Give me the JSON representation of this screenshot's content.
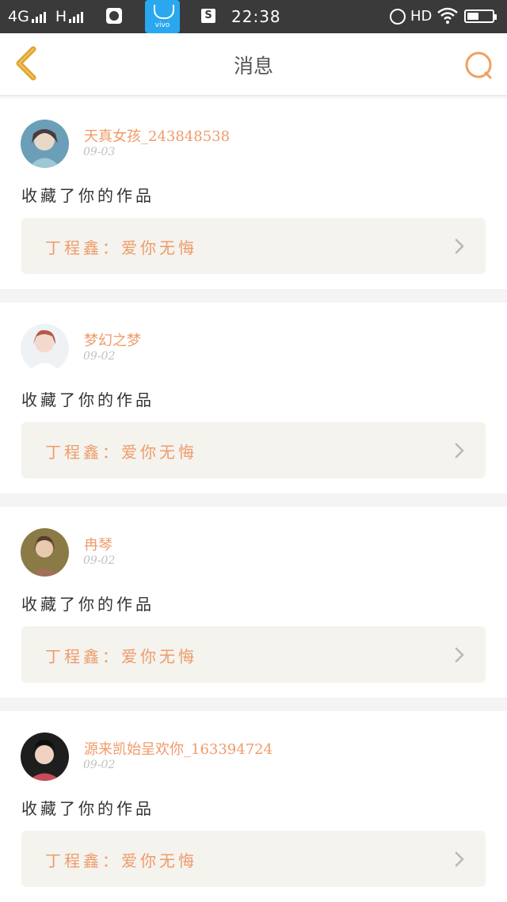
{
  "status_bar": {
    "network": "4G",
    "network2": "H",
    "vivo_label": "vivo",
    "s_badge": "S",
    "time": "22:38",
    "hd": "HD",
    "battery_level": 0.45
  },
  "header": {
    "title": "消息",
    "accent_color": "#f0a060"
  },
  "messages": [
    {
      "username": "天真女孩_243848538",
      "date": "09-03",
      "action": "收藏了你的作品",
      "work_title": "丁程鑫：爱你无悔",
      "avatar_color": "#6b9fb8"
    },
    {
      "username": "梦幻之梦",
      "date": "09-02",
      "action": "收藏了你的作品",
      "work_title": "丁程鑫：爱你无悔",
      "avatar_color": "#d9a4a0"
    },
    {
      "username": "冉琴",
      "date": "09-02",
      "action": "收藏了你的作品",
      "work_title": "丁程鑫：爱你无悔",
      "avatar_color": "#8a7a45"
    },
    {
      "username": "源来凯始呈欢你_163394724",
      "date": "09-02",
      "action": "收藏了你的作品",
      "work_title": "丁程鑫：爱你无悔",
      "avatar_color": "#2a2a2a"
    }
  ]
}
